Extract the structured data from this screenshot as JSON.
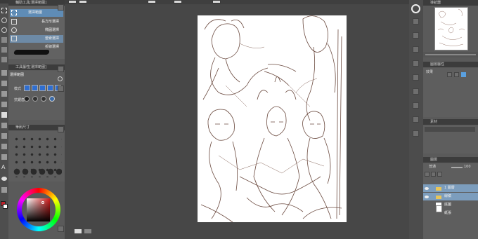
{
  "subtool": {
    "header": "輔助工具[選擇範圍]",
    "items": [
      {
        "label": "選擇範圍",
        "selected": true
      },
      {
        "label": "長方形選擇",
        "selected": false
      },
      {
        "label": "橢圓選擇",
        "selected": false
      },
      {
        "label": "套索選擇",
        "selected": false
      },
      {
        "label": "折線選擇",
        "selected": false
      }
    ]
  },
  "tool_property": {
    "header": "工具屬性[選擇範圍]",
    "title": "選擇範圍",
    "mode_label": "模式",
    "aa_label": "抗鋸齒"
  },
  "brush_size": {
    "header": "筆刷尺寸"
  },
  "navigator": {
    "header": "導航器"
  },
  "layer_property": {
    "header": "圖層屬性",
    "effect_label": "效果"
  },
  "material": {
    "header": "素材"
  },
  "layer": {
    "header": "圖層",
    "blend_mode": "普通",
    "opacity": "100",
    "layers": [
      {
        "name": "1 圖層",
        "selected": true
      },
      {
        "name": "線稿",
        "selected": false
      },
      {
        "name": "底圖",
        "selected": false
      },
      {
        "name": "紙張",
        "selected": false
      }
    ]
  },
  "colors": {
    "accent": "#5f8cb6",
    "canvas_bg": "#474747",
    "panel": "#5a5a5a",
    "main_color": "#c0202a"
  }
}
